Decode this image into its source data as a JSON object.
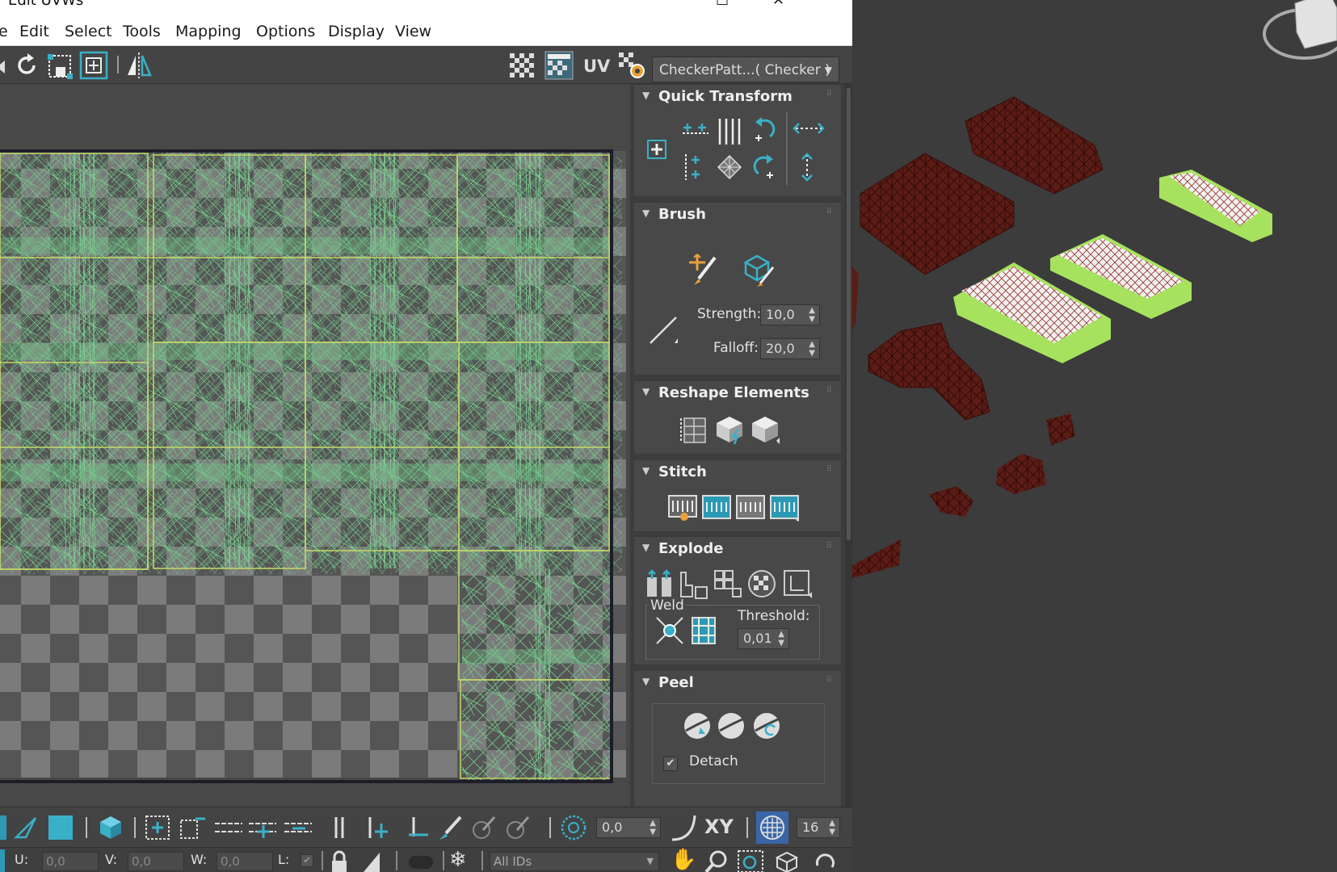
{
  "window": {
    "title": "Edit UVWs",
    "maximize_icon": "maximize-icon",
    "close_icon": "close-icon"
  },
  "menu": [
    "e",
    "Edit",
    "Select",
    "Tools",
    "Mapping",
    "Options",
    "Display",
    "View"
  ],
  "toolbar": {
    "uv_label": "UV",
    "checker_value": "CheckerPatt...( Checker )",
    "icons": [
      "redo-icon",
      "freeform-icon",
      "fit-icon",
      "mirror-icon",
      "grid-icon",
      "checker-icon",
      "settings-gear-icon"
    ]
  },
  "quick_transform": {
    "title": "Quick Transform",
    "icons": [
      "add-icon",
      "align-horizontal-icon",
      "space-vertical-icon",
      "rotate-ccw-icon",
      "align-vertical-icon",
      "align-pattern-icon",
      "rotate-cw-icon",
      "space-horizontal-icon",
      "space-vertical-alt-icon"
    ]
  },
  "brush": {
    "title": "Brush",
    "strength_label": "Strength:",
    "strength_value": "10,0",
    "falloff_label": "Falloff:",
    "falloff_value": "20,0",
    "icons": [
      "paint-move-icon",
      "relax-brush-icon",
      "falloff-line-icon"
    ]
  },
  "reshape": {
    "title": "Reshape Elements",
    "icons": [
      "straighten-icon",
      "relax-icon",
      "relax-alt-icon"
    ]
  },
  "stitch": {
    "title": "Stitch",
    "icons": [
      "stitch-custom-icon",
      "stitch-source-icon",
      "stitch-average-icon",
      "stitch-target-icon"
    ]
  },
  "explode": {
    "title": "Explode",
    "weld_label": "Weld",
    "threshold_label": "Threshold:",
    "threshold_value": "0,01",
    "icons": [
      "break-icon",
      "detach-icon",
      "flatten-icon",
      "explode-grid-icon",
      "explode-uv-icon",
      "weld-selected-icon",
      "weld-target-icon"
    ]
  },
  "peel": {
    "title": "Peel",
    "detach_label": "Detach",
    "detach_checked": true,
    "icons": [
      "quick-peel-icon",
      "peel-mode-icon",
      "reset-peel-icon"
    ]
  },
  "bottom": {
    "angle_value": "0,0",
    "xy_label": "XY",
    "grid_value": "16",
    "u_label": "U:",
    "u_value": "0,0",
    "v_label": "V:",
    "v_value": "0,0",
    "w_label": "W:",
    "w_value": "0,0",
    "l_label": "L:",
    "ids_value": "All IDs"
  },
  "colors": {
    "uv_wire": "#74c98a",
    "element_border": "#c6d96a",
    "model_dark": "#5c1c16",
    "model_selected": "#a7e25e"
  }
}
